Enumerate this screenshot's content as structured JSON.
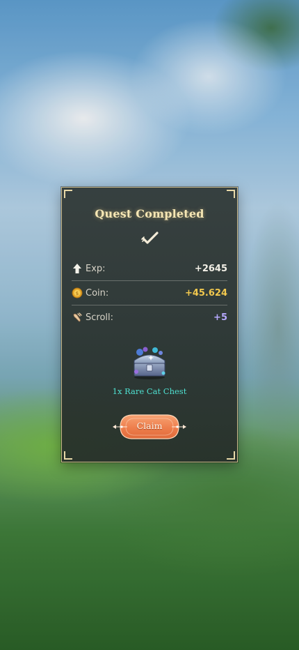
{
  "panel": {
    "title": "Quest Completed",
    "rewards": [
      {
        "icon": "up-arrow-icon",
        "label": "Exp:",
        "value": "+2645",
        "color": "#f2efe6"
      },
      {
        "icon": "coin-icon",
        "label": "Coin:",
        "value": "+45.624",
        "color": "#f3c94e"
      },
      {
        "icon": "scroll-icon",
        "label": "Scroll:",
        "value": "+5",
        "color": "#b6a9ff"
      }
    ],
    "item": {
      "icon": "treasure-chest-icon",
      "label": "1x Rare Cat Chest"
    },
    "claim_label": "Claim"
  },
  "colors": {
    "accent_gold": "#f5e6b4",
    "button_orange": "#f08a5a",
    "item_text": "#4fe0d0"
  }
}
